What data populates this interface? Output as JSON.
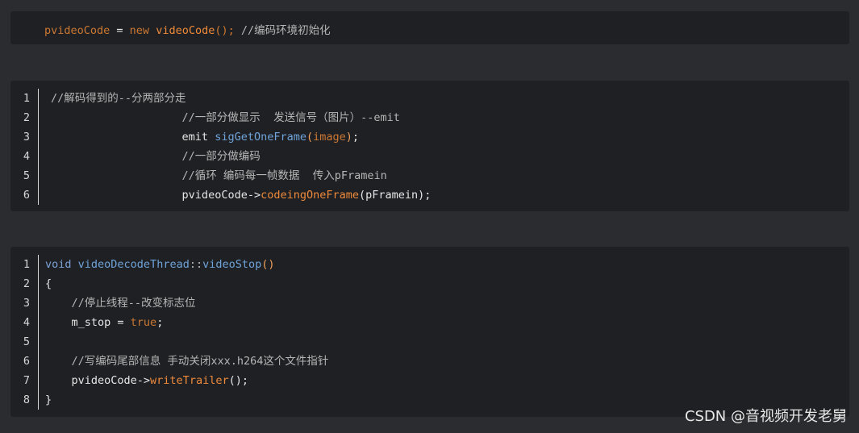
{
  "block1": {
    "tokens": [
      {
        "text": "pvideoCode",
        "cls": "kw"
      },
      {
        "text": " = ",
        "cls": "plain"
      },
      {
        "text": "new",
        "cls": "kw"
      },
      {
        "text": " ",
        "cls": "plain"
      },
      {
        "text": "videoCode",
        "cls": "fn"
      },
      {
        "text": "();",
        "cls": "kw"
      },
      {
        "text": " //编码环境初始化",
        "cls": "comment"
      }
    ]
  },
  "block2": {
    "line_numbers": [
      "1",
      "2",
      "3",
      "4",
      "5",
      "6"
    ],
    "lines": [
      [
        {
          "text": "//解码得到的--分两部分走",
          "cls": "comment"
        }
      ],
      [
        {
          "text": "                    //一部分做显示  发送信号（图片）--emit",
          "cls": "comment"
        }
      ],
      [
        {
          "text": "                    emit ",
          "cls": "plain"
        },
        {
          "text": "sigGetOneFrame",
          "cls": "fn-blue"
        },
        {
          "text": "(",
          "cls": "paren"
        },
        {
          "text": "image",
          "cls": "kw"
        },
        {
          "text": ")",
          "cls": "paren"
        },
        {
          "text": ";",
          "cls": "sem"
        }
      ],
      [
        {
          "text": "                    //一部分做编码",
          "cls": "comment"
        }
      ],
      [
        {
          "text": "                    //循环 编码每一帧数据  传入pFramein",
          "cls": "comment"
        }
      ],
      [
        {
          "text": "                    pvideoCode->",
          "cls": "plain"
        },
        {
          "text": "codeingOneFrame",
          "cls": "fn"
        },
        {
          "text": "(pFramein);",
          "cls": "plain"
        }
      ]
    ]
  },
  "block3": {
    "line_numbers": [
      "1",
      "2",
      "3",
      "4",
      "5",
      "6",
      "7",
      "8"
    ],
    "lines": [
      [
        {
          "text": "void",
          "cls": "kw-blue"
        },
        {
          "text": " ",
          "cls": "plain"
        },
        {
          "text": "videoDecodeThread",
          "cls": "fn-blue"
        },
        {
          "text": "::",
          "cls": "comment"
        },
        {
          "text": "videoStop",
          "cls": "fn-blue"
        },
        {
          "text": "()",
          "cls": "paren"
        }
      ],
      [
        {
          "text": "{",
          "cls": "plain"
        }
      ],
      [
        {
          "text": "    //停止线程--改变标志位",
          "cls": "comment"
        }
      ],
      [
        {
          "text": "    m_stop = ",
          "cls": "plain"
        },
        {
          "text": "true",
          "cls": "kw"
        },
        {
          "text": ";",
          "cls": "sem"
        }
      ],
      [
        {
          "text": "",
          "cls": "plain"
        }
      ],
      [
        {
          "text": "    //写编码尾部信息 手动关闭xxx.h264这个文件指针",
          "cls": "comment"
        }
      ],
      [
        {
          "text": "    pvideoCode->",
          "cls": "plain"
        },
        {
          "text": "writeTrailer",
          "cls": "fn"
        },
        {
          "text": "();",
          "cls": "plain"
        }
      ],
      [
        {
          "text": "}",
          "cls": "plain"
        }
      ]
    ]
  },
  "watermark": "CSDN @音视频开发老舅"
}
